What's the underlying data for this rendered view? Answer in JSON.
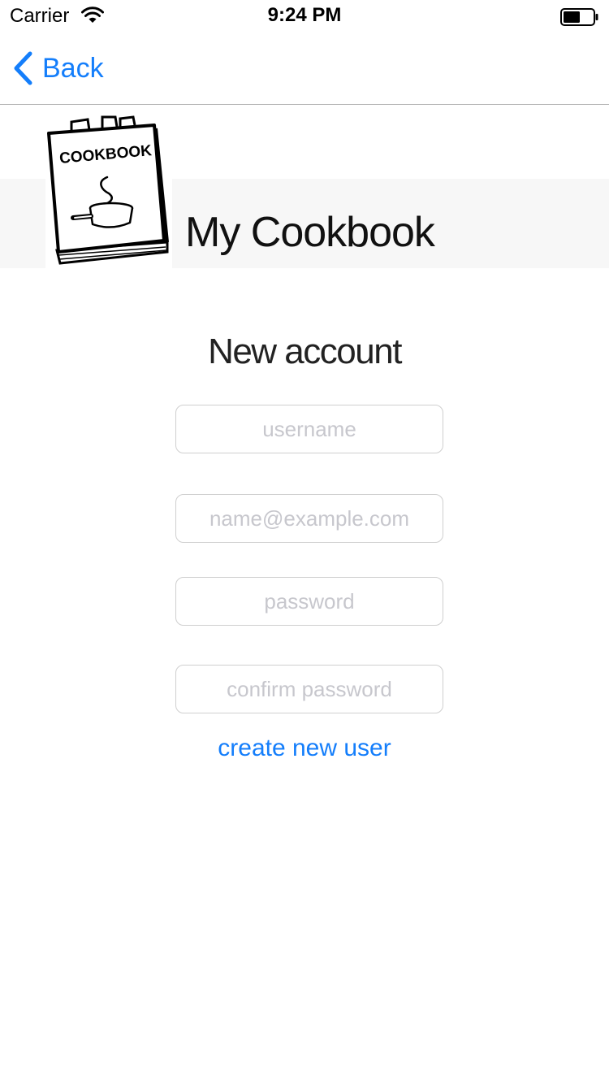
{
  "status_bar": {
    "carrier": "Carrier",
    "time": "9:24 PM",
    "icons": [
      "wifi-icon",
      "battery-icon"
    ]
  },
  "nav": {
    "back_label": "Back",
    "accent_color": "#147efb"
  },
  "header": {
    "logo_text": "COOKBOOK",
    "app_title": "My Cookbook",
    "band_color": "#f7f7f7"
  },
  "form": {
    "title": "New account",
    "username": {
      "value": "",
      "placeholder": "username"
    },
    "email": {
      "value": "",
      "placeholder": "name@example.com"
    },
    "password": {
      "value": "",
      "placeholder": "password"
    },
    "confirm_password": {
      "value": "",
      "placeholder": "confirm password"
    },
    "submit_label": "create new user"
  }
}
